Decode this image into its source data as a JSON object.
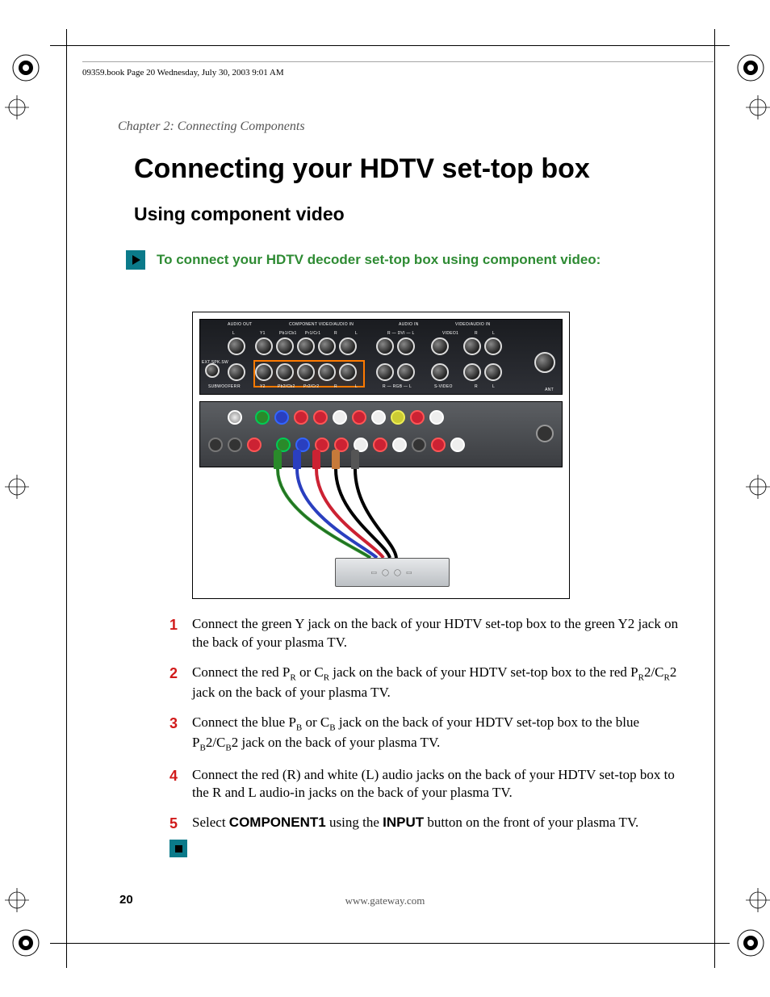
{
  "header_text": "09359.book  Page 20  Wednesday, July 30, 2003  9:01 AM",
  "chapter": "Chapter 2: Connecting Components",
  "title": "Connecting your HDTV set-top box",
  "subtitle": "Using component video",
  "lead": "To connect your HDTV decoder set-top box using component video:",
  "panel": {
    "groups": [
      "AUDIO OUT",
      "COMPONENT VIDEO/AUDIO IN",
      "AUDIO IN",
      "VIDEO/AUDIO IN"
    ],
    "row1": [
      "L",
      "Y1",
      "Pb1/Cb1",
      "Pr1/Cr1",
      "R",
      "L",
      "R — DVI — L",
      "VIDEO1",
      "R",
      "L"
    ],
    "row2_left": "EXT.SPK.SW",
    "row2_bottom": "SUBWOOFER",
    "row2": [
      "R",
      "Y2",
      "Pb2/Cb2",
      "Pr2/Cr2",
      "R",
      "L",
      "R — RGB — L",
      "S-VIDEO",
      "R",
      "L"
    ],
    "ant": "ANT"
  },
  "steps": [
    {
      "n": "1",
      "text": "Connect the green Y jack on the back of your HDTV set-top box to the green Y2 jack on the back of your plasma TV."
    },
    {
      "n": "2",
      "text_parts": [
        "Connect the red P",
        "R",
        " or C",
        "R",
        " jack on the back of your HDTV set-top box to the red P",
        "R",
        "2/C",
        "R",
        "2 jack on the back of your plasma TV."
      ]
    },
    {
      "n": "3",
      "text_parts": [
        "Connect the blue P",
        "B",
        " or C",
        "B",
        " jack on the back of your HDTV set-top box to the blue P",
        "B",
        "2/C",
        "B",
        "2 jack on the back of your plasma TV."
      ]
    },
    {
      "n": "4",
      "text": "Connect the red (R) and white (L) audio jacks on the back of your HDTV set-top box to the R and L audio-in jacks on the back of your plasma TV."
    },
    {
      "n": "5",
      "text_parts": [
        "Select ",
        "COMPONENT1",
        " using the ",
        "INPUT",
        " button on the front of your plasma TV."
      ]
    }
  ],
  "page_number": "20",
  "footer_url": "www.gateway.com"
}
